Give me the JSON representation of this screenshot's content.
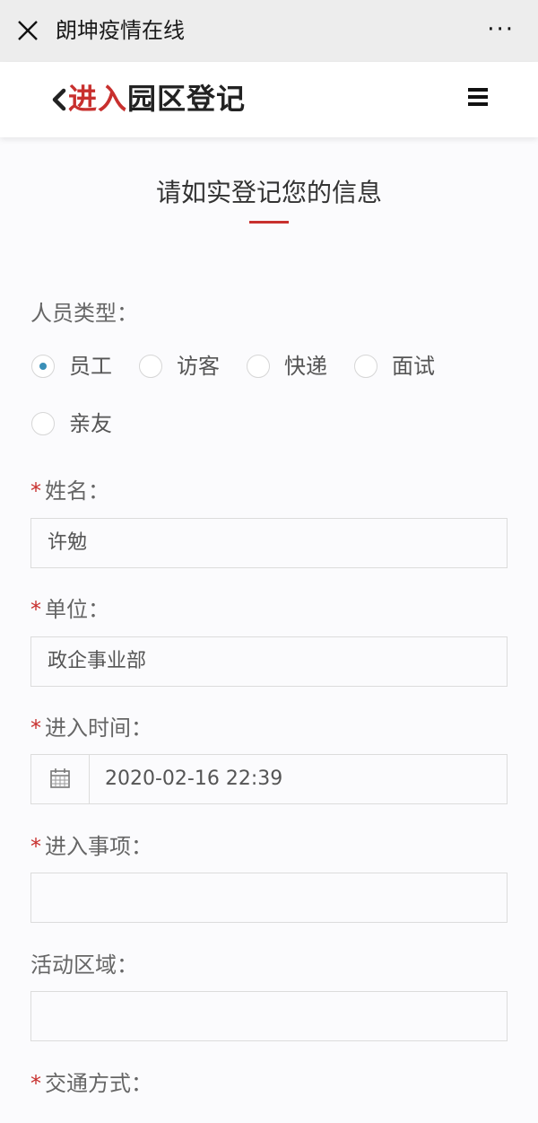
{
  "window": {
    "title": "朗坤疫情在线",
    "more_label": "···"
  },
  "header": {
    "back_icon": "chevron-left-icon",
    "title_red": "进入",
    "title_dark": "园区登记",
    "menu_icon": "hamburger-menu-icon"
  },
  "form": {
    "title": "请如实登记您的信息",
    "accent_color": "#c8302e",
    "person_type": {
      "label": "人员类型：",
      "options": [
        "员工",
        "访客",
        "快递",
        "面试",
        "亲友"
      ],
      "selected": "员工"
    },
    "name": {
      "label": "姓名：",
      "required": true,
      "value": "许勉"
    },
    "unit": {
      "label": "单位：",
      "required": true,
      "value": "政企事业部"
    },
    "entry_time": {
      "label": "进入时间：",
      "required": true,
      "value": "2020-02-16 22:39",
      "icon": "calendar-icon"
    },
    "entry_matter": {
      "label": "进入事项：",
      "required": true,
      "value": ""
    },
    "activity_area": {
      "label": "活动区域：",
      "required": false,
      "value": ""
    },
    "transport": {
      "label": "交通方式：",
      "required": true
    },
    "required_mark": "*"
  }
}
